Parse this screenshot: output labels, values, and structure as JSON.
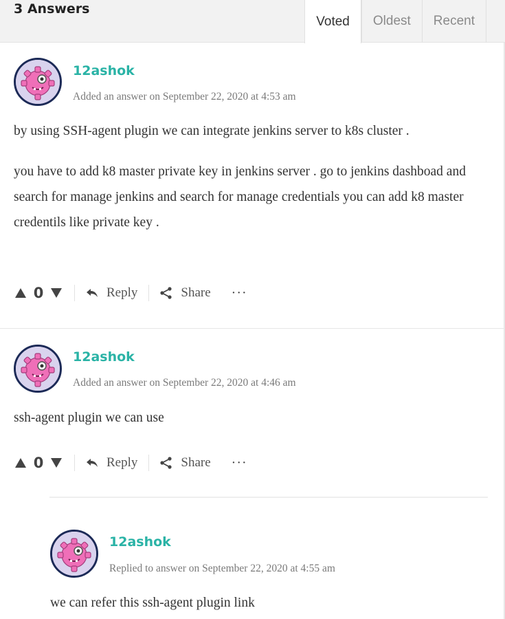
{
  "header": {
    "answer_count": "3 Answers",
    "tabs": [
      {
        "label": "Voted",
        "active": true
      },
      {
        "label": "Oldest",
        "active": false
      },
      {
        "label": "Recent",
        "active": false
      }
    ]
  },
  "answers": [
    {
      "author": "12ashok",
      "meta": "Added an answer on September 22, 2020 at 4:53 am",
      "paragraphs": [
        "by using SSH-agent plugin  we can integrate jenkins server to k8s cluster .",
        "you have to  add k8 master private key in jenkins server  . go to jenkins dashboad and search for manage jenkins and search for manage credentials you can add k8 master credentils like private key ."
      ],
      "votes": "0",
      "reply_label": "Reply",
      "share_label": "Share",
      "more_label": "···"
    },
    {
      "author": "12ashok",
      "meta": "Added an answer on September 22, 2020 at 4:46 am",
      "paragraphs": [
        "ssh-agent plugin we can use"
      ],
      "votes": "0",
      "reply_label": "Reply",
      "share_label": "Share",
      "more_label": "···"
    }
  ],
  "reply": {
    "author": "12ashok",
    "meta": "Replied to answer on September 22, 2020 at 4:55 am",
    "text": "we can refer this ssh-agent plugin link"
  },
  "colors": {
    "author": "#2ab3a6",
    "avatar_ring": "#1c2a57",
    "avatar_pink": "#ef6fb8"
  },
  "icons": {
    "avatar": "gear-monster-avatar",
    "upvote": "triangle-up-icon",
    "downvote": "triangle-down-icon",
    "reply": "reply-arrow-icon",
    "share": "share-icon"
  }
}
